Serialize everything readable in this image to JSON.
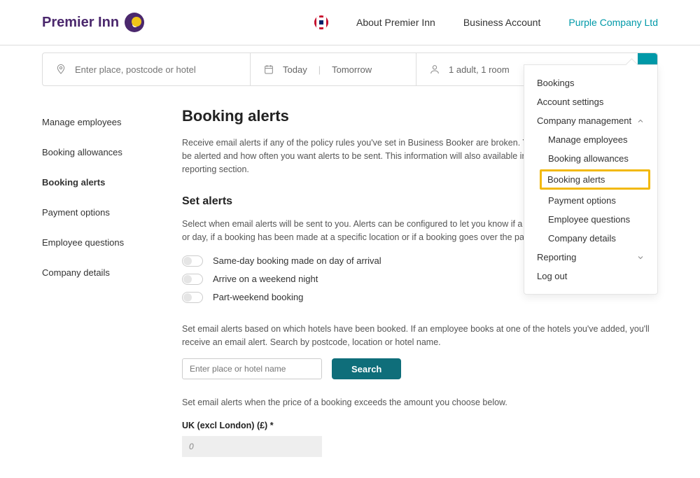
{
  "header": {
    "brand": "Premier Inn",
    "nav": {
      "about": "About Premier Inn",
      "business": "Business Account",
      "account": "Purple Company Ltd"
    }
  },
  "searchbar": {
    "place_placeholder": "Enter place, postcode or hotel",
    "today": "Today",
    "tomorrow": "Tomorrow",
    "guests": "1 adult, 1 room"
  },
  "sidebar": {
    "items": [
      "Manage employees",
      "Booking allowances",
      "Booking alerts",
      "Payment options",
      "Employee questions",
      "Company details"
    ]
  },
  "main": {
    "title": "Booking alerts",
    "intro": "Receive email alerts if any of the policy rules you've set in Business Booker are broken. You can choose who you want to be alerted and how often you want alerts to be sent. This information will also available in your out of policy report in the reporting section.",
    "set_alerts_title": "Set alerts",
    "set_alerts_desc": "Select when email alerts will be sent to you. Alerts can be configured to let you know if a booking is made for a certain time or day, if a booking has been made at a specific location or if a booking goes over the payment threshold you set below.",
    "toggles": [
      "Same-day booking made on day of arrival",
      "Arrive on a weekend night",
      "Part-weekend booking"
    ],
    "hotel_desc": "Set email alerts based on which hotels have been booked. If an employee books at one of the hotels you've added, you'll receive an email alert. Search by postcode, location or hotel name.",
    "hotel_placeholder": "Enter place or hotel name",
    "search_btn": "Search",
    "price_desc": "Set email alerts when the price of a booking exceeds the amount you choose below.",
    "price_label": "UK (excl London) (£) *",
    "price_value": "0"
  },
  "dropdown": {
    "bookings": "Bookings",
    "account_settings": "Account settings",
    "company_mgmt": "Company management",
    "subs": {
      "manage_employees": "Manage employees",
      "booking_allowances": "Booking allowances",
      "booking_alerts": "Booking alerts",
      "payment_options": "Payment options",
      "employee_questions": "Employee questions",
      "company_details": "Company details"
    },
    "reporting": "Reporting",
    "logout": "Log out"
  }
}
